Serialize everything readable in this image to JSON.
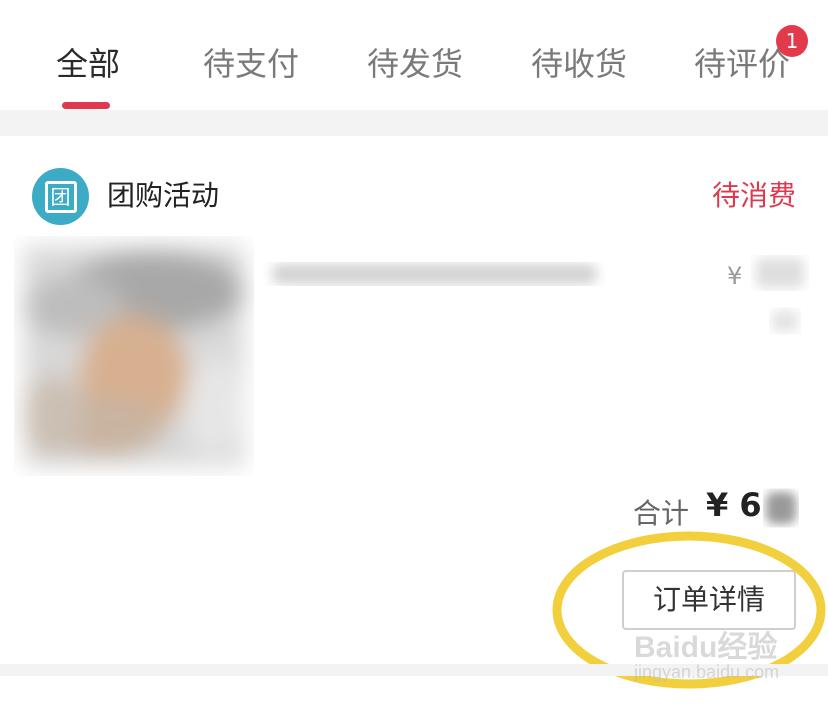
{
  "tabs": [
    {
      "label": "全部",
      "active": true
    },
    {
      "label": "待支付",
      "active": false
    },
    {
      "label": "待发货",
      "active": false
    },
    {
      "label": "待收货",
      "active": false
    },
    {
      "label": "待评价",
      "active": false,
      "badge": "1"
    }
  ],
  "order": {
    "shop": {
      "icon": "团",
      "name": "团购活动"
    },
    "status": "待消费",
    "price_symbol": "¥",
    "total": {
      "label": "合计",
      "value": "¥ 6"
    },
    "detail_button": "订单详情"
  },
  "watermark": {
    "main": "Baidu经验",
    "sub": "jingyan.baidu.com"
  },
  "colors": {
    "accent": "#e0384f",
    "badge": "#e33a4b",
    "shop_logo": "#3cabc5",
    "highlight": "#f2cf3d"
  }
}
